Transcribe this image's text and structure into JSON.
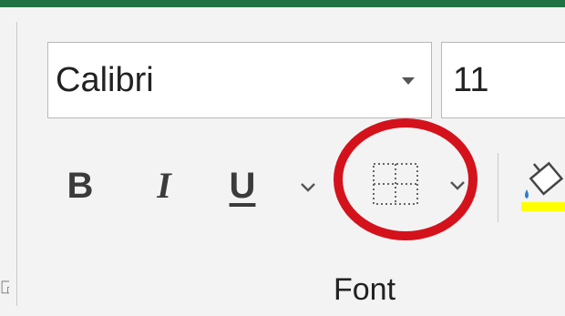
{
  "font_group": {
    "font_name": {
      "value": "Calibri"
    },
    "font_size": {
      "value": "11"
    },
    "bold": {
      "label": "B"
    },
    "italic": {
      "label": "I"
    },
    "underline": {
      "label": "U"
    },
    "label": "Font"
  },
  "colors": {
    "accent_bar": "#217346",
    "highlight_circle": "#d4121c",
    "fill_color": "#ffff00"
  },
  "icons": [
    "dropdown-arrow-icon",
    "chevron-down-icon",
    "borders-icon",
    "fill-color-icon"
  ]
}
